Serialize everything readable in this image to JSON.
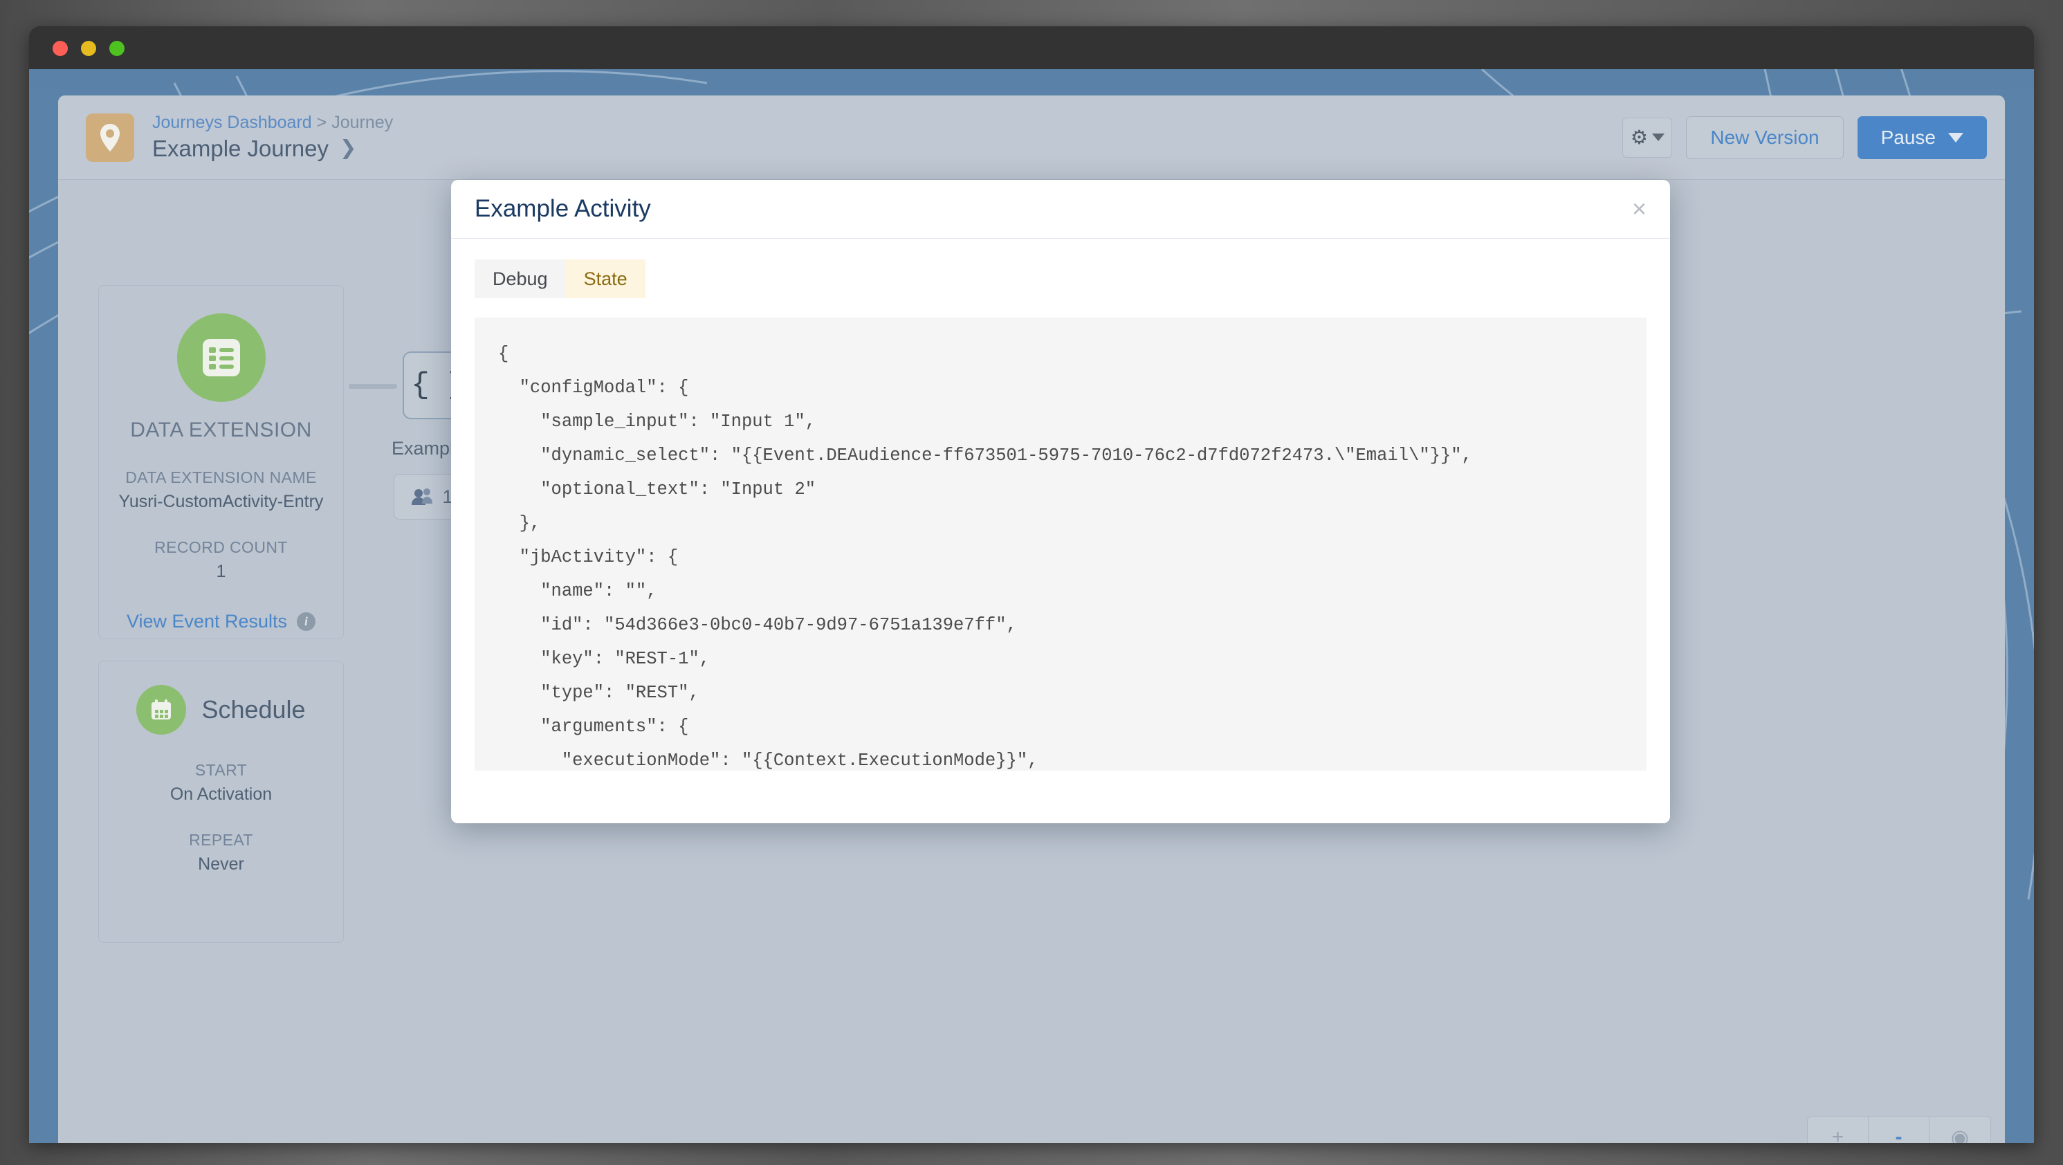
{
  "window": {
    "traffic_lights": [
      "close",
      "minimize",
      "maximize"
    ]
  },
  "header": {
    "journey_icon": "location-pin-icon",
    "breadcrumb": {
      "link": "Journeys Dashboard",
      "separator": ">",
      "current": "Journey"
    },
    "title": "Example Journey",
    "title_chevron": "❯",
    "settings_icon": "gear-icon",
    "buttons": {
      "new_version": "New Version",
      "pause": "Pause"
    }
  },
  "entry_card": {
    "icon": "data-extension-icon",
    "type_label": "DATA EXTENSION",
    "name_label": "DATA EXTENSION NAME",
    "name_value": "Yusri-CustomActivity-Entry",
    "count_label": "RECORD COUNT",
    "count_value": "1",
    "link_label": "View Event Results",
    "info_icon": "info-icon"
  },
  "schedule_card": {
    "icon": "calendar-icon",
    "title": "Schedule",
    "start_label": "START",
    "start_value": "On Activation",
    "repeat_label": "REPEAT",
    "repeat_value": "Never"
  },
  "canvas": {
    "activity_node_glyph": "{ }",
    "activity_label": "Example Ac",
    "contacts_icon": "people-icon",
    "contacts_count": "1"
  },
  "zoom_controls": {
    "zoom_in": "+",
    "zoom_out": "-",
    "reset": "◉"
  },
  "modal": {
    "title": "Example Activity",
    "close_icon": "close-icon",
    "tabs": [
      {
        "label": "Debug",
        "active": false
      },
      {
        "label": "State",
        "active": true
      }
    ],
    "code": "{\n  \"configModal\": {\n    \"sample_input\": \"Input 1\",\n    \"dynamic_select\": \"{{Event.DEAudience-ff673501-5975-7010-76c2-d7fd072f2473.\\\"Email\\\"}}\",\n    \"optional_text\": \"Input 2\"\n  },\n  \"jbActivity\": {\n    \"name\": \"\",\n    \"id\": \"54d366e3-0bc0-40b7-9d97-6751a139e7ff\",\n    \"key\": \"REST-1\",\n    \"type\": \"REST\",\n    \"arguments\": {\n      \"executionMode\": \"{{Context.ExecutionMode}}\",\n      \"definitionId\": \"{{Context.DefinitionId}}\",\n      \"activityId\": \"{{Activity.Id}}\",\n      \"contactKey\": \"{{Context.ContactKey}}\",\n      \"execute\": {"
  },
  "colors": {
    "accent_blue": "#4a86c8",
    "green_icon": "#8cbe6f",
    "tan_badge": "#cfad7c",
    "app_surface": "#bcc5d0",
    "page_background": "#5b82a8",
    "state_tab_bg": "#fdf5e0",
    "state_tab_text": "#8a6b11"
  }
}
